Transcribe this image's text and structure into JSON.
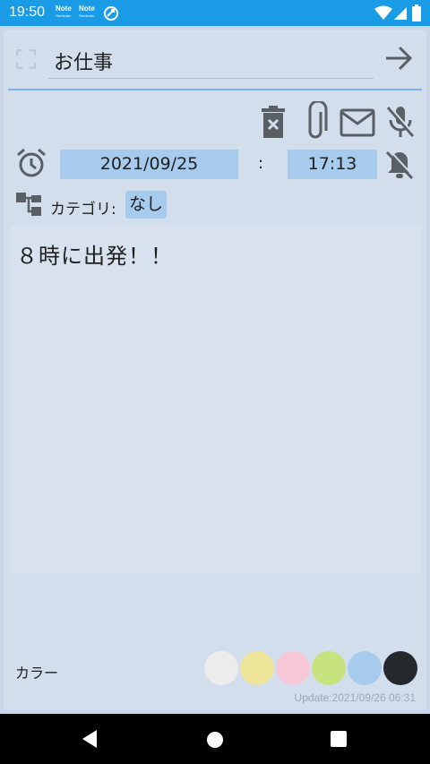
{
  "status_bar": {
    "time": "19:50",
    "notifications": [
      {
        "label": "Note",
        "sub": "Reminder"
      },
      {
        "label": "Note",
        "sub": "Reminder"
      }
    ],
    "icons": [
      "sync-icon",
      "wifi-icon",
      "signal-icon",
      "battery-icon"
    ]
  },
  "header": {
    "title": "お仕事"
  },
  "toolbar": {
    "icons": [
      "delete-icon",
      "attachment-icon",
      "mail-icon",
      "mic-off-icon"
    ]
  },
  "alarm": {
    "date": "2021/09/25",
    "separator": ":",
    "time": "17:13"
  },
  "category": {
    "label": "カテゴリ:",
    "value": "なし"
  },
  "note": {
    "body": "８時に出発！！"
  },
  "color": {
    "label": "カラー",
    "swatches": [
      "#ececec",
      "#efe59a",
      "#f6c8d7",
      "#c6e37d",
      "#a6cbed",
      "#25282d"
    ]
  },
  "footer": {
    "update": "Update:2021/09/26 06:31"
  },
  "colors": {
    "status_bar": "#1a9be6",
    "surface": "#d3deed",
    "field_highlight": "#a6cbed",
    "divider": "#7fb3e8"
  }
}
